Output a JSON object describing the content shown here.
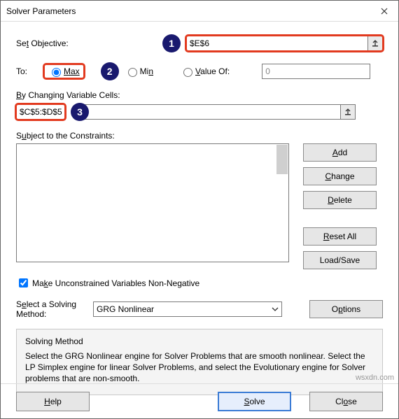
{
  "window": {
    "title": "Solver Parameters"
  },
  "setObjective": {
    "label": "Set Objective:",
    "value": "$E$6"
  },
  "to": {
    "label": "To:",
    "max": "Max",
    "min": "Min",
    "valueOf": "Value Of:",
    "valueField": "0",
    "selected": "max"
  },
  "changing": {
    "label": "By Changing Variable Cells:",
    "value": "$C$5:$D$5"
  },
  "constraints": {
    "label": "Subject to the Constraints:"
  },
  "sideButtons": {
    "add": "Add",
    "change": "Change",
    "delete": "Delete",
    "resetAll": "Reset All",
    "loadSave": "Load/Save"
  },
  "unconstrained": {
    "label": "Make Unconstrained Variables Non-Negative",
    "checked": true
  },
  "method": {
    "label": "Select a Solving Method:",
    "selected": "GRG Nonlinear",
    "options": "Options"
  },
  "desc": {
    "title": "Solving Method",
    "body": "Select the GRG Nonlinear engine for Solver Problems that are smooth nonlinear. Select the LP Simplex engine for linear Solver Problems, and select the Evolutionary engine for Solver problems that are non-smooth."
  },
  "footer": {
    "help": "Help",
    "solve": "Solve",
    "close": "Close"
  },
  "badges": {
    "b1": "1",
    "b2": "2",
    "b3": "3"
  },
  "watermark": "wsxdn.com"
}
